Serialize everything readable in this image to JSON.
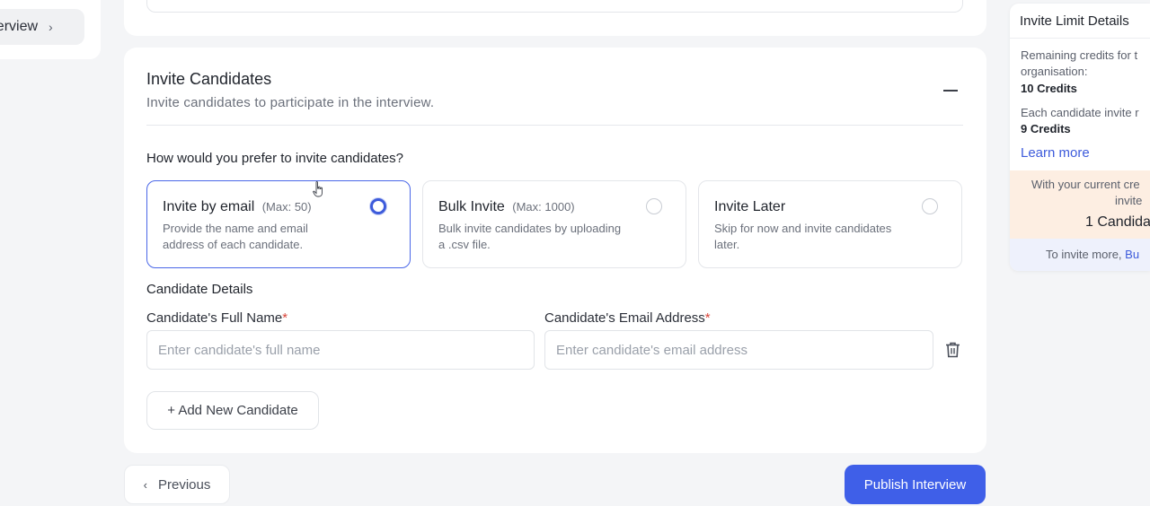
{
  "stepper": {
    "current_step": "Interview"
  },
  "invite_section": {
    "title": "Invite Candidates",
    "subtitle": "Invite candidates to participate in the interview.",
    "question": "How would you prefer to invite candidates?",
    "options": [
      {
        "label": "Invite by email",
        "max": "(Max: 50)",
        "description": "Provide the name and email address of each candidate.",
        "selected": true
      },
      {
        "label": "Bulk Invite",
        "max": "(Max: 1000)",
        "description": "Bulk invite candidates by uploading a .csv file.",
        "selected": false
      },
      {
        "label": "Invite Later",
        "max": "",
        "description": "Skip for now and invite candidates later.",
        "selected": false
      }
    ]
  },
  "candidate_details": {
    "heading": "Candidate Details",
    "name_label": "Candidate's Full Name",
    "email_label": "Candidate's Email Address",
    "required_mark": "*",
    "name_placeholder": "Enter candidate's full name",
    "email_placeholder": "Enter candidate's email address",
    "add_button": "+ Add New Candidate"
  },
  "footer": {
    "previous": "Previous",
    "publish": "Publish Interview"
  },
  "side_panel": {
    "title": "Invite Limit Details",
    "remaining_label": "Remaining credits for t",
    "remaining_label_2": "organisation:",
    "remaining_value": "10 Credits",
    "each_label": "Each candidate invite r",
    "each_value": "9 Credits",
    "learn_more": "Learn more",
    "warning_line1": "With your current cre",
    "warning_line2": "invite",
    "warning_big": "1 Candida",
    "more_text": "To invite more,",
    "more_link": "Bu"
  },
  "colors": {
    "accent": "#3f5fe8",
    "required": "#d9453a",
    "warning_bg": "#fdeee2",
    "info_bg": "#eef1fc"
  }
}
